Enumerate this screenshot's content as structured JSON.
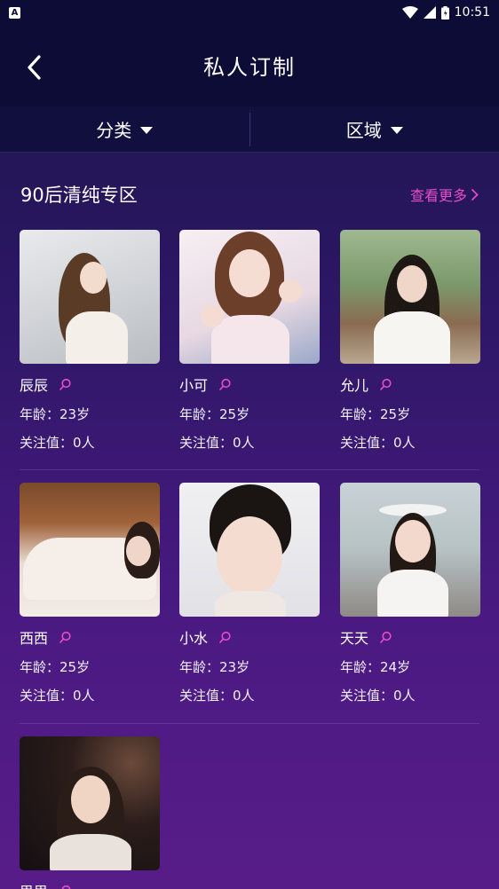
{
  "status_bar": {
    "app_badge": "A",
    "time": "10:51"
  },
  "header": {
    "title": "私人订制"
  },
  "filters": [
    {
      "label": "分类"
    },
    {
      "label": "区域"
    }
  ],
  "section": {
    "title": "90后清纯专区",
    "more_label": "查看更多"
  },
  "labels": {
    "age_prefix": "年龄：",
    "follow_prefix": "关注值："
  },
  "profiles": [
    {
      "name": "辰辰",
      "age": "23岁",
      "follow": "0人"
    },
    {
      "name": "小可",
      "age": "25岁",
      "follow": "0人"
    },
    {
      "name": "允儿",
      "age": "25岁",
      "follow": "0人"
    },
    {
      "name": "西西",
      "age": "25岁",
      "follow": "0人"
    },
    {
      "name": "小水",
      "age": "23岁",
      "follow": "0人"
    },
    {
      "name": "天天",
      "age": "24岁",
      "follow": "0人"
    },
    {
      "name": "思思",
      "age": "",
      "follow": ""
    }
  ],
  "colors": {
    "accent": "#e84cc9",
    "header_bg": "#0c0c36",
    "gradient_bottom": "#581c88"
  }
}
